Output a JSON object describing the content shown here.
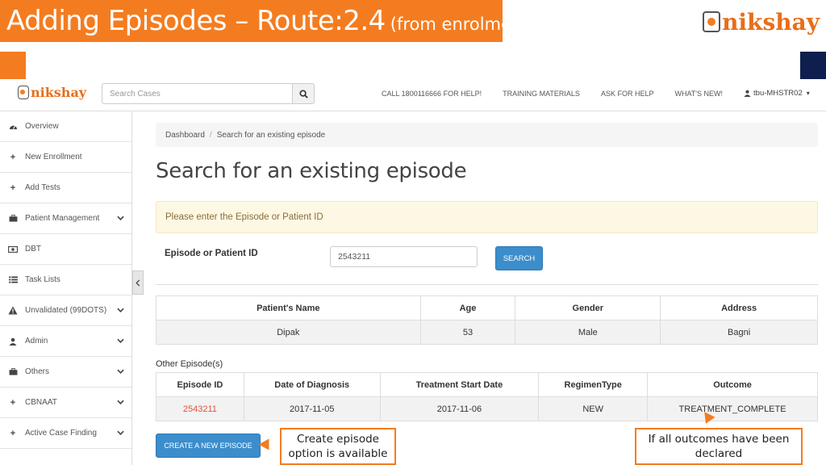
{
  "slide": {
    "title_main": "Adding Episodes – Route:2.4",
    "title_sub": "(from enrolment)",
    "logo_text": "nikshay"
  },
  "navbar": {
    "logo_text": "nikshay",
    "search_placeholder": "Search Cases",
    "links": [
      "CALL 1800116666 FOR HELP!",
      "TRAINING MATERIALS",
      "ASK FOR HELP",
      "WHAT'S NEW!"
    ],
    "user": "tbu-MHSTR02"
  },
  "sidebar": {
    "items": [
      {
        "label": "Overview",
        "icon": "dashboard-icon"
      },
      {
        "label": "New Enrollment",
        "icon": "plus-icon"
      },
      {
        "label": "Add Tests",
        "icon": "plus-icon"
      },
      {
        "label": "Patient Management",
        "icon": "briefcase-icon",
        "has_children": true
      },
      {
        "label": "DBT",
        "icon": "money-icon"
      },
      {
        "label": "Task Lists",
        "icon": "list-icon"
      },
      {
        "label": "Unvalidated (99DOTS)",
        "icon": "warning-icon",
        "has_children": true
      },
      {
        "label": "Admin",
        "icon": "user-icon",
        "has_children": true
      },
      {
        "label": "Others",
        "icon": "briefcase-icon",
        "has_children": true
      },
      {
        "label": "CBNAAT",
        "icon": "plus-icon",
        "has_children": true
      },
      {
        "label": "Active Case Finding",
        "icon": "plus-icon",
        "has_children": true
      }
    ]
  },
  "breadcrumb": {
    "home": "Dashboard",
    "current": "Search for an existing episode"
  },
  "page_title": "Search for an existing episode",
  "alert_text": "Please enter the Episode or Patient ID",
  "form": {
    "label": "Episode or Patient ID",
    "value": "2543211",
    "button": "SEARCH"
  },
  "patient_table": {
    "headers": [
      "Patient's Name",
      "Age",
      "Gender",
      "Address"
    ],
    "row": [
      "Dipak",
      "53",
      "Male",
      "Bagni"
    ]
  },
  "other_episodes_label": "Other Episode(s)",
  "episodes_table": {
    "headers": [
      "Episode ID",
      "Date of Diagnosis",
      "Treatment Start Date",
      "RegimenType",
      "Outcome"
    ],
    "row": [
      "2543211",
      "2017-11-05",
      "2017-11-06",
      "NEW",
      "TREATMENT_COMPLETE"
    ]
  },
  "create_button": "CREATE A NEW EPISODE",
  "callouts": {
    "create": "Create episode option is available",
    "outcomes": "If all outcomes have been declared"
  },
  "colors": {
    "accent": "#f47c20",
    "primary": "#3c8dcc",
    "link": "#e0533b"
  }
}
